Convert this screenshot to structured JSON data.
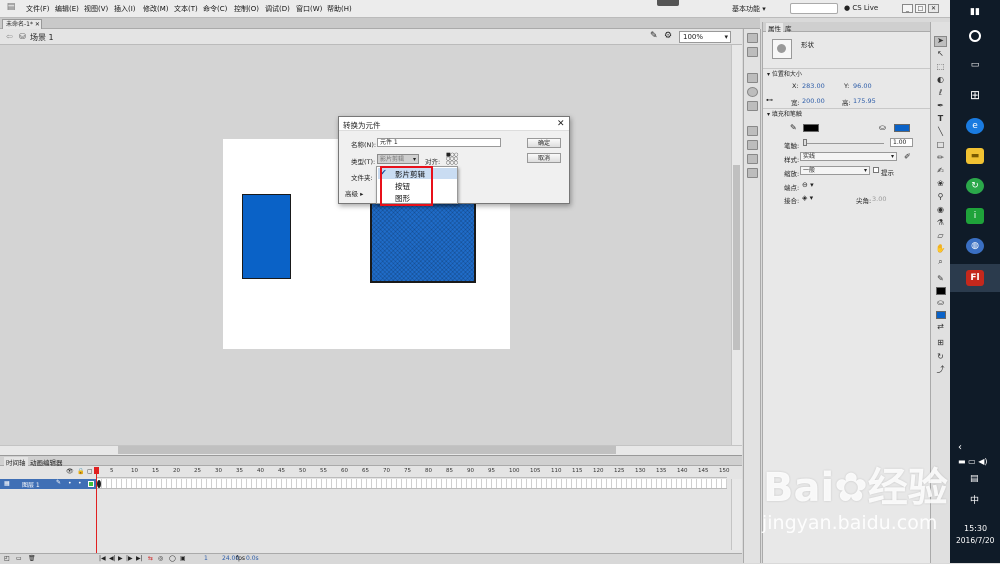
{
  "menubar": {
    "items": [
      "文件(F)",
      "编辑(E)",
      "视图(V)",
      "插入(I)",
      "修改(M)",
      "文本(T)",
      "命令(C)",
      "控制(O)",
      "调试(D)",
      "窗口(W)",
      "帮助(H)"
    ],
    "workspace": "基本功能",
    "cslive": "CS Live"
  },
  "document": {
    "tab": "未命名-1*",
    "scene": "场景 1",
    "zoom": "100%"
  },
  "dialog": {
    "title": "转换为元件",
    "name_label": "名称(N):",
    "name_value": "元件 1",
    "type_label": "类型(T):",
    "type_value": "影片剪辑",
    "align_label": "对齐:",
    "folder_label": "文件夹:",
    "advanced_label": "高级",
    "ok": "确定",
    "cancel": "取消",
    "options": [
      "影片剪辑",
      "按钮",
      "图形"
    ],
    "selected_option": "影片剪辑"
  },
  "properties": {
    "tab_props": "属性",
    "tab_library": "库",
    "object_type": "形状",
    "section_pos": "位置和大小",
    "x_label": "X:",
    "x_value": "283.00",
    "y_label": "Y:",
    "y_value": "96.00",
    "w_label": "宽:",
    "w_value": "200.00",
    "h_label": "高:",
    "h_value": "175.95",
    "section_fill": "填充和笔触",
    "stroke_color": "#000000",
    "fill_color": "#0a62c7",
    "stroke_label": "笔触:",
    "stroke_value": "1.00",
    "style_label": "样式:",
    "style_value": "实线",
    "scale_label": "缩放:",
    "scale_value": "一般",
    "hint_label": "提示",
    "cap_label": "端点:",
    "join_label": "接合:",
    "miter_label": "尖角:",
    "miter_value": "3.00"
  },
  "timeline": {
    "tab_timeline": "时间轴",
    "tab_motion": "动画编辑器",
    "layer": "图层 1",
    "ruler": [
      "5",
      "10",
      "15",
      "20",
      "25",
      "30",
      "35",
      "40",
      "45",
      "50",
      "55",
      "60",
      "65",
      "70",
      "75",
      "80",
      "85",
      "90",
      "95",
      "100",
      "105",
      "110",
      "115",
      "120",
      "125",
      "130",
      "135",
      "140",
      "145",
      "150"
    ],
    "frame": "1",
    "fps": "24.00",
    "fps_unit": "fps",
    "time": "0.0s"
  },
  "taskbar": {
    "time": "15:30",
    "date": "2016/7/20",
    "ime": "中"
  },
  "watermark": {
    "brand": "Bai",
    "brand2": "经验",
    "url": "jingyan.baidu.com"
  }
}
